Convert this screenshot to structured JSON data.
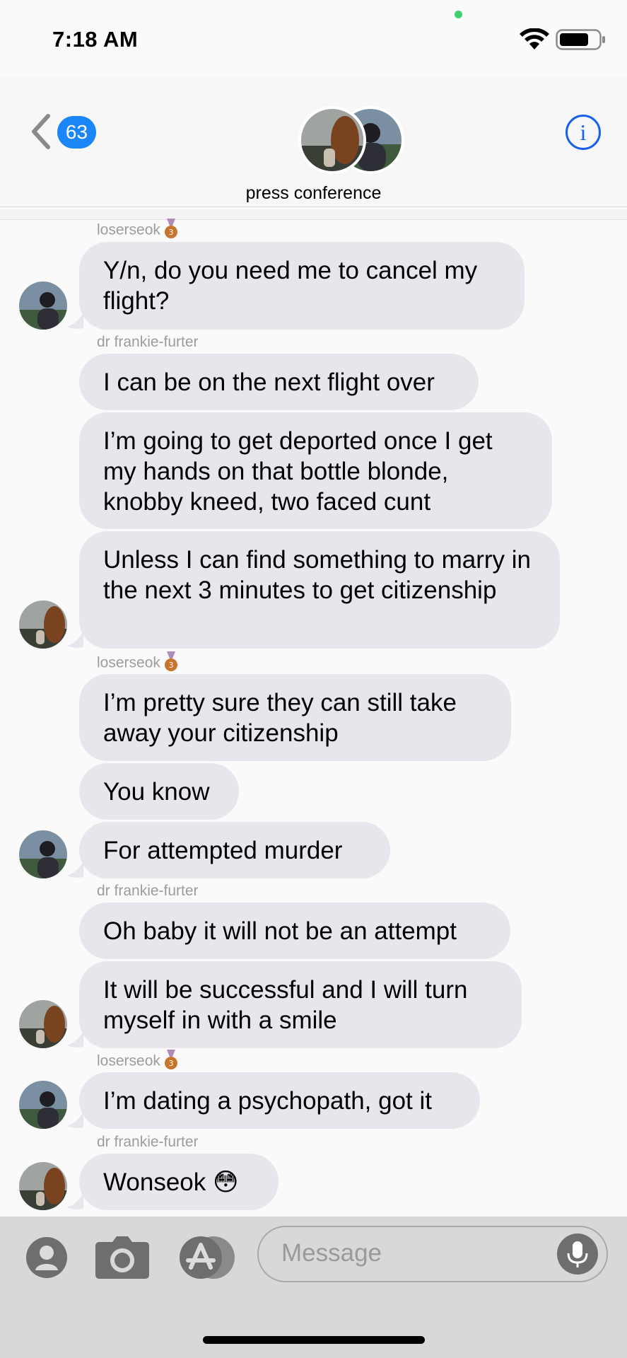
{
  "status_bar": {
    "time": "7:18 AM"
  },
  "header": {
    "back_badge": "63",
    "conversation_name": "press conference",
    "info_symbol": "i"
  },
  "messages": [
    {
      "sender": "loserseok",
      "text": "Y/n, do you need me to cancel my flight?"
    },
    {
      "sender": "dr frankie-furter",
      "text": "I can be on the next flight over"
    },
    {
      "text": "I’m going to get deported once I get my hands on that bottle blonde, knobby kneed, two faced cunt"
    },
    {
      "text": "Unless I can find something to marry in the next 3 minutes to get citizenship"
    },
    {
      "sender": "loserseok",
      "text": "I’m pretty sure they can still take away your citizenship"
    },
    {
      "text": "You know"
    },
    {
      "text": "For attempted murder"
    },
    {
      "sender": "dr frankie-furter",
      "text": "Oh baby it will not be an attempt"
    },
    {
      "text": "It will be successful and I will turn myself in with a smile"
    },
    {
      "sender": "loserseok",
      "text": "I’m dating a psychopath, got it"
    },
    {
      "sender": "dr frankie-furter",
      "text": "Wonseok 😳"
    }
  ],
  "input": {
    "placeholder": "Message"
  },
  "icons": {
    "back": "chevron-left-icon",
    "info": "info-icon",
    "wifi": "wifi-icon",
    "battery": "battery-icon",
    "contact": "contact-icon",
    "camera": "camera-icon",
    "apps": "app-store-icon",
    "mic": "microphone-icon",
    "medal": "bronze-medal-icon"
  },
  "colors": {
    "accent": "#1b86f7",
    "bubble": "#e8e6ec",
    "background": "#fafafa",
    "sender_label": "#9c9ca0",
    "input_bar": "#d8d8d8"
  }
}
